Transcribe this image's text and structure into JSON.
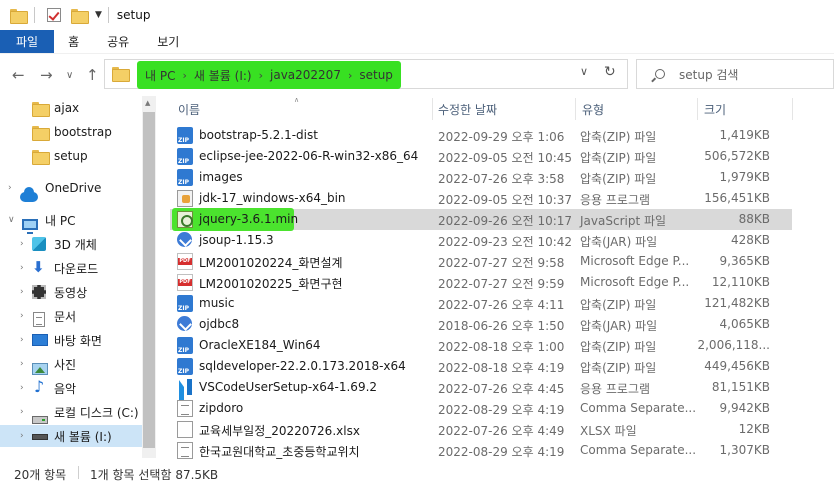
{
  "title_bar": {
    "title": "setup"
  },
  "ribbon": {
    "tabs": [
      "파일",
      "홈",
      "공유",
      "보기"
    ]
  },
  "address": {
    "crumbs": [
      "내 PC",
      "새 볼륨 (I:)",
      "java202207",
      "setup"
    ],
    "search_placeholder": "setup 검색"
  },
  "nav_pane": {
    "items": [
      {
        "label": "ajax",
        "icon": "folder-icon"
      },
      {
        "label": "bootstrap",
        "icon": "folder-icon"
      },
      {
        "label": "setup",
        "icon": "folder-icon"
      },
      {
        "label": "OneDrive",
        "icon": "onedrive-icon"
      },
      {
        "label": "내 PC",
        "icon": "pc-icon"
      },
      {
        "label": "3D 개체",
        "icon": "3d-objects-icon"
      },
      {
        "label": "다운로드",
        "icon": "download-icon"
      },
      {
        "label": "동영상",
        "icon": "videos-icon"
      },
      {
        "label": "문서",
        "icon": "documents-icon"
      },
      {
        "label": "바탕 화면",
        "icon": "desktop-icon"
      },
      {
        "label": "사진",
        "icon": "pictures-icon"
      },
      {
        "label": "음악",
        "icon": "music-icon"
      },
      {
        "label": "로컬 디스크 (C:)",
        "icon": "local-disk-icon"
      },
      {
        "label": "새 볼륨 (I:)",
        "icon": "volume-icon"
      }
    ]
  },
  "file_list": {
    "columns": [
      "이름",
      "수정한 날짜",
      "유형",
      "크기"
    ],
    "rows": [
      {
        "name": "bootstrap-5.2.1-dist",
        "date": "2022-09-29 오후 1:06",
        "type": "압축(ZIP) 파일",
        "size": "1,419KB",
        "icon": "zip"
      },
      {
        "name": "eclipse-jee-2022-06-R-win32-x86_64",
        "date": "2022-09-05 오전 10:45",
        "type": "압축(ZIP) 파일",
        "size": "506,572KB",
        "icon": "zip"
      },
      {
        "name": "images",
        "date": "2022-07-26 오후 3:58",
        "type": "압축(ZIP) 파일",
        "size": "1,979KB",
        "icon": "zip"
      },
      {
        "name": "jdk-17_windows-x64_bin",
        "date": "2022-09-05 오전 10:37",
        "type": "응용 프로그램",
        "size": "156,451KB",
        "icon": "app"
      },
      {
        "name": "jquery-3.6.1.min",
        "date": "2022-09-26 오전 10:17",
        "type": "JavaScript 파일",
        "size": "88KB",
        "icon": "js"
      },
      {
        "name": "jsoup-1.15.3",
        "date": "2022-09-23 오전 10:42",
        "type": "압축(JAR) 파일",
        "size": "428KB",
        "icon": "jar"
      },
      {
        "name": "LM2001020224_화면설계",
        "date": "2022-07-27 오전 9:58",
        "type": "Microsoft Edge P...",
        "size": "9,365KB",
        "icon": "pdf"
      },
      {
        "name": "LM2001020225_화면구현",
        "date": "2022-07-27 오전 9:59",
        "type": "Microsoft Edge P...",
        "size": "12,110KB",
        "icon": "pdf"
      },
      {
        "name": "music",
        "date": "2022-07-26 오후 4:11",
        "type": "압축(ZIP) 파일",
        "size": "121,482KB",
        "icon": "zip"
      },
      {
        "name": "ojdbc8",
        "date": "2018-06-26 오후 1:50",
        "type": "압축(JAR) 파일",
        "size": "4,065KB",
        "icon": "jar"
      },
      {
        "name": "OracleXE184_Win64",
        "date": "2022-08-18 오후 1:00",
        "type": "압축(ZIP) 파일",
        "size": "2,006,118...",
        "icon": "zip"
      },
      {
        "name": "sqldeveloper-22.2.0.173.2018-x64",
        "date": "2022-08-18 오후 4:19",
        "type": "압축(ZIP) 파일",
        "size": "449,456KB",
        "icon": "zip"
      },
      {
        "name": "VSCodeUserSetup-x64-1.69.2",
        "date": "2022-07-26 오후 4:45",
        "type": "응용 프로그램",
        "size": "81,151KB",
        "icon": "vs"
      },
      {
        "name": "zipdoro",
        "date": "2022-08-29 오후 4:19",
        "type": "Comma Separate...",
        "size": "9,942KB",
        "icon": "txt"
      },
      {
        "name": "교육세부일정_20220726.xlsx",
        "date": "2022-07-26 오후 4:49",
        "type": "XLSX 파일",
        "size": "12KB",
        "icon": "xlsx"
      },
      {
        "name": "한국교원대학교_초중등학교위치",
        "date": "2022-08-29 오후 4:19",
        "type": "Comma Separate...",
        "size": "1,307KB",
        "icon": "txt"
      }
    ]
  },
  "status_bar": {
    "count": "20개 항목",
    "selection": "1개 항목 선택함 87.5KB"
  },
  "colors": {
    "ribbon_active": "#1a5fb4",
    "highlight": "#38e022",
    "selected_row": "#d9d9d9",
    "nav_selected": "#cce4f7"
  }
}
